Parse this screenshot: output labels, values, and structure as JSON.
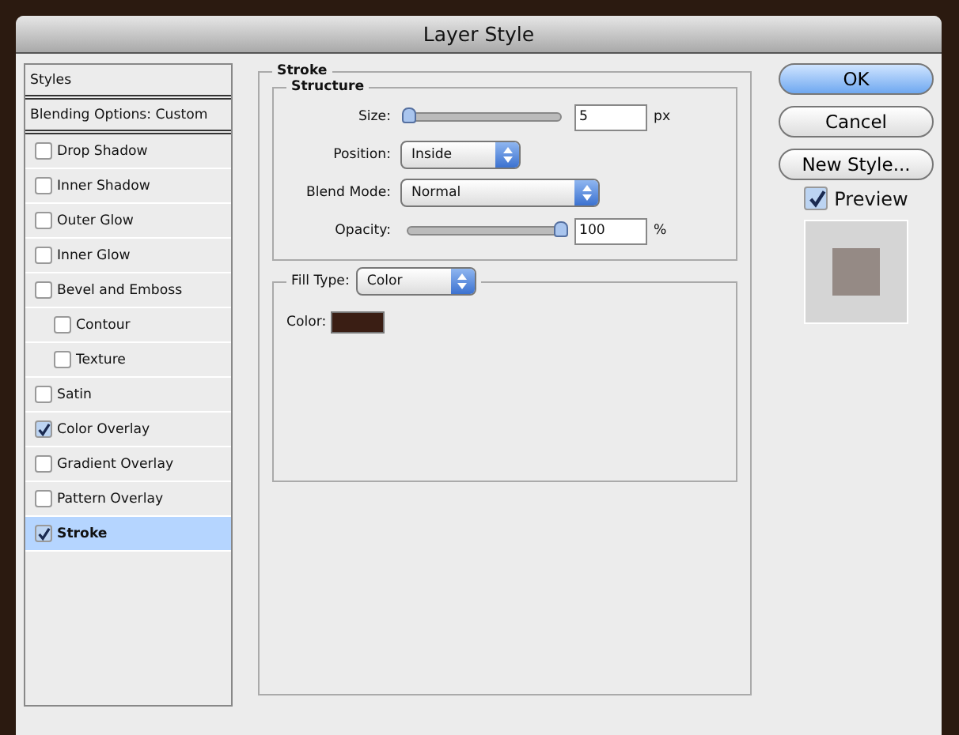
{
  "window": {
    "title": "Layer Style"
  },
  "sidebar": {
    "items": [
      {
        "kind": "header",
        "label": "Styles",
        "selected": false
      },
      {
        "kind": "header",
        "label": "Blending Options: Custom",
        "selected": false
      },
      {
        "kind": "effect",
        "label": "Drop Shadow",
        "checked": false,
        "selected": false
      },
      {
        "kind": "effect",
        "label": "Inner Shadow",
        "checked": false,
        "selected": false
      },
      {
        "kind": "effect",
        "label": "Outer Glow",
        "checked": false,
        "selected": false
      },
      {
        "kind": "effect",
        "label": "Inner Glow",
        "checked": false,
        "selected": false
      },
      {
        "kind": "effect",
        "label": "Bevel and Emboss",
        "checked": false,
        "selected": false,
        "children": [
          {
            "kind": "effect",
            "label": "Contour",
            "checked": false,
            "selected": false
          },
          {
            "kind": "effect",
            "label": "Texture",
            "checked": false,
            "selected": false
          }
        ]
      },
      {
        "kind": "effect",
        "label": "Satin",
        "checked": false,
        "selected": false
      },
      {
        "kind": "effect",
        "label": "Color Overlay",
        "checked": true,
        "selected": false
      },
      {
        "kind": "effect",
        "label": "Gradient Overlay",
        "checked": false,
        "selected": false
      },
      {
        "kind": "effect",
        "label": "Pattern Overlay",
        "checked": false,
        "selected": false
      },
      {
        "kind": "effect",
        "label": "Stroke",
        "checked": true,
        "selected": true
      }
    ]
  },
  "panel": {
    "title": "Stroke",
    "structure": {
      "title": "Structure",
      "size": {
        "label": "Size:",
        "level": 0.0,
        "value": "5",
        "unit": "px"
      },
      "position": {
        "label": "Position:",
        "value": "Inside"
      },
      "blend_mode": {
        "label": "Blend Mode:",
        "value": "Normal"
      },
      "opacity": {
        "label": "Opacity:",
        "level": 1.0,
        "value": "100",
        "unit": "%"
      }
    },
    "fill_type": {
      "label": "Fill Type:",
      "value": "Color",
      "color_label": "Color:",
      "color": "#3a1e14"
    }
  },
  "buttons": [
    {
      "label": "OK",
      "default": true
    },
    {
      "label": "Cancel",
      "default": false
    },
    {
      "label": "New Style...",
      "default": false
    }
  ],
  "preview": {
    "label": "Preview",
    "checked": true,
    "color": "#958a85"
  }
}
